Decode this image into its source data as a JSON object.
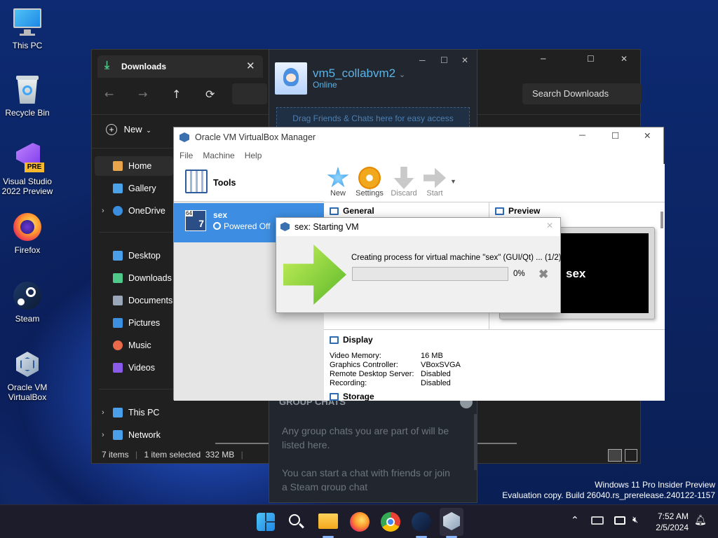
{
  "desktop": {
    "icons": [
      {
        "label": "This PC",
        "icon": "monitor-icon"
      },
      {
        "label": "Recycle Bin",
        "icon": "recycle-bin-icon"
      },
      {
        "label": "Visual Studio 2022 Preview",
        "icon": "visual-studio-icon",
        "badge": "PRE"
      },
      {
        "label": "Firefox",
        "icon": "firefox-icon"
      },
      {
        "label": "Steam",
        "icon": "steam-icon"
      },
      {
        "label": "Oracle VM VirtualBox",
        "icon": "virtualbox-icon"
      }
    ],
    "watermark_line1": "Windows 11 Pro Insider Preview",
    "watermark_line2": "Evaluation copy. Build 26040.rs_prerelease.240122-1157"
  },
  "explorer": {
    "tab_title": "Downloads",
    "search_placeholder": "Search Downloads",
    "new_label": "New",
    "sidebar": [
      {
        "label": "Home",
        "icon": "home-icon",
        "color": "#e8a44a"
      },
      {
        "label": "Gallery",
        "icon": "gallery-icon",
        "color": "#4aa3e8"
      },
      {
        "label": "OneDrive",
        "icon": "cloud-icon",
        "color": "#3b8ede"
      },
      {
        "label": "Desktop",
        "icon": "desktop-icon",
        "color": "#4a9fe8"
      },
      {
        "label": "Downloads",
        "icon": "download-icon",
        "color": "#4ec98a"
      },
      {
        "label": "Documents",
        "icon": "documents-icon",
        "color": "#9aa7b8"
      },
      {
        "label": "Pictures",
        "icon": "pictures-icon",
        "color": "#3d8fe0"
      },
      {
        "label": "Music",
        "icon": "music-icon",
        "color": "#e86a4a"
      },
      {
        "label": "Videos",
        "icon": "videos-icon",
        "color": "#8a5ae8"
      },
      {
        "label": "This PC",
        "icon": "pc-icon",
        "color": "#4a9fe8"
      },
      {
        "label": "Network",
        "icon": "network-icon",
        "color": "#4a9fe8"
      }
    ],
    "status_items": "7 items",
    "status_selected": "1 item selected  332 MB"
  },
  "steam": {
    "username": "vm5_collabvm2",
    "status": "Online",
    "drag_hint": "Drag Friends & Chats here for easy access",
    "group_chats_header": "GROUP CHATS",
    "group_text1": "Any group chats you are part of will be listed here.",
    "group_text2": "You can start a chat with friends or join a Steam group chat"
  },
  "vbox": {
    "title": "Oracle VM VirtualBox Manager",
    "menu": [
      "File",
      "Machine",
      "Help"
    ],
    "tools_label": "Tools",
    "vm_name": "sex",
    "vm_state": "Powered Off",
    "vm_badge": "64",
    "toolbar": {
      "new": "New",
      "settings": "Settings",
      "discard": "Discard",
      "start": "Start"
    },
    "general_label": "General",
    "preview_label": "Preview",
    "preview_text": "sex",
    "display_label": "Display",
    "display_rows": [
      {
        "k": "Video Memory:",
        "v": "16 MB"
      },
      {
        "k": "Graphics Controller:",
        "v": "VBoxSVGA"
      },
      {
        "k": "Remote Desktop Server:",
        "v": "Disabled"
      },
      {
        "k": "Recording:",
        "v": "Disabled"
      }
    ],
    "storage_label": "Storage"
  },
  "dialog": {
    "title": "sex: Starting VM",
    "message": "Creating process for virtual machine \"sex\" (GUI/Qt) ... (1/2)",
    "progress_text": "0%",
    "progress": 0
  },
  "taskbar": {
    "time": "7:52 AM",
    "date": "2/5/2024"
  }
}
